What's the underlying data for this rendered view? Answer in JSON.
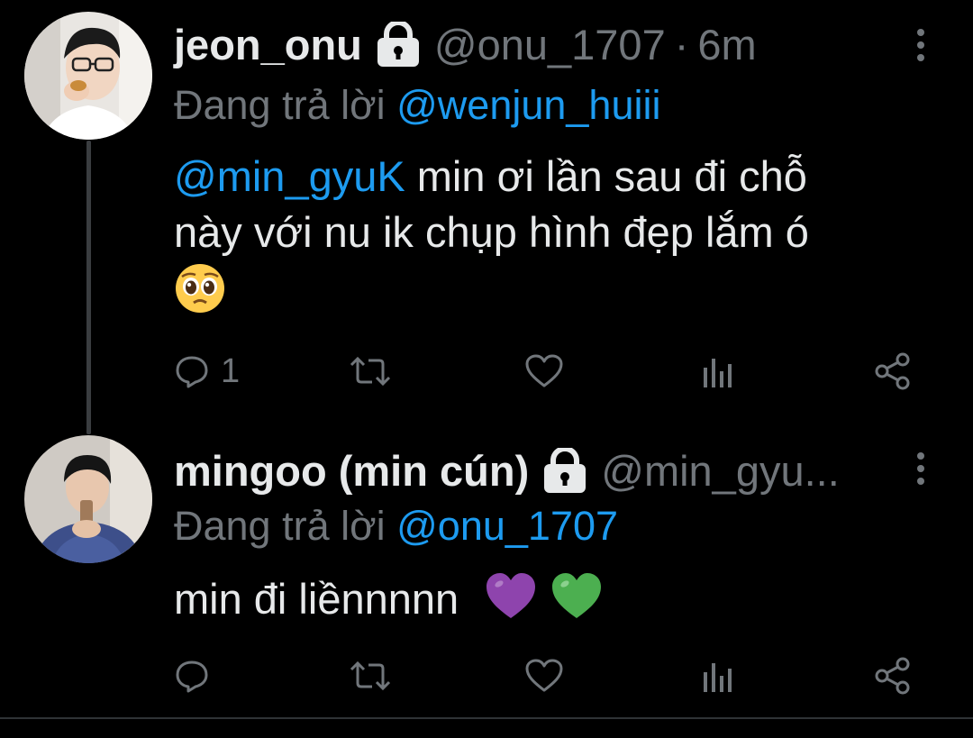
{
  "colors": {
    "background": "#000000",
    "text_primary": "#e7e9ea",
    "text_secondary": "#71767b",
    "mention": "#1d9bf0",
    "heart_purple": "#8e44ad",
    "heart_green": "#4caf50"
  },
  "tweets": [
    {
      "display_name": "jeon_onu",
      "handle": "@onu_1707",
      "separator": "·",
      "time": "6m",
      "locked_icon": "lock-icon",
      "reply_prefix": "Đang trả lời",
      "reply_to": "@wenjun_huiii",
      "body_mention": "@min_gyuK",
      "body_text_line1": " min ơi lần sau đi chỗ",
      "body_text_line2": "này với nu ik chụp hình đẹp lắm ó",
      "body_emoji": "pleading-face",
      "reply_count": "1"
    },
    {
      "display_name": "mingoo (min cún)",
      "handle": "@min_gyu...",
      "locked_icon": "lock-icon",
      "reply_prefix": "Đang trả lời",
      "reply_to": "@onu_1707",
      "body_text": "min đi liềnnnnn",
      "body_emojis": [
        "purple-heart",
        "green-heart"
      ]
    }
  ]
}
